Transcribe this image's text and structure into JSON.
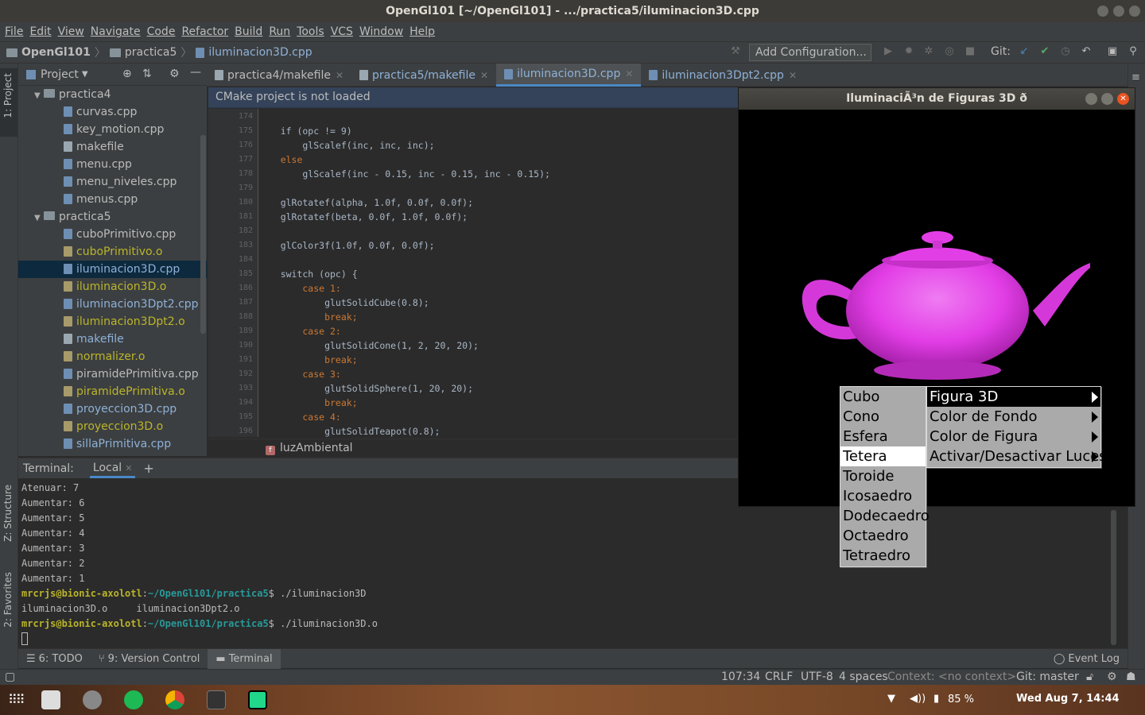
{
  "window": {
    "title": "OpenGl101 [~/OpenGl101] - .../practica5/iluminacion3D.cpp"
  },
  "menubar": [
    "File",
    "Edit",
    "View",
    "Navigate",
    "Code",
    "Refactor",
    "Build",
    "Run",
    "Tools",
    "VCS",
    "Window",
    "Help"
  ],
  "breadcrumb": {
    "project": "OpenGl101",
    "folder": "practica5",
    "file": "iluminacion3D.cpp"
  },
  "toolbar": {
    "add_configuration": "Add Configuration...",
    "git_label": "Git:"
  },
  "project_panel": {
    "title": "Project",
    "strip_label": "1: Project",
    "tree": [
      {
        "label": "practica4",
        "kind": "folder"
      },
      {
        "label": "curvas.cpp",
        "kind": "cpp"
      },
      {
        "label": "key_motion.cpp",
        "kind": "cpp"
      },
      {
        "label": "makefile",
        "kind": "file"
      },
      {
        "label": "menu.cpp",
        "kind": "cpp"
      },
      {
        "label": "menu_niveles.cpp",
        "kind": "cpp"
      },
      {
        "label": "menus.cpp",
        "kind": "cpp"
      },
      {
        "label": "practica5",
        "kind": "folder"
      },
      {
        "label": "cuboPrimitivo.cpp",
        "kind": "cpp"
      },
      {
        "label": "cuboPrimitivo.o",
        "kind": "obj"
      },
      {
        "label": "iluminacion3D.cpp",
        "kind": "cpp"
      },
      {
        "label": "iluminacion3D.o",
        "kind": "obj"
      },
      {
        "label": "iluminacion3Dpt2.cpp",
        "kind": "cpp"
      },
      {
        "label": "iluminacion3Dpt2.o",
        "kind": "obj"
      },
      {
        "label": "makefile",
        "kind": "file"
      },
      {
        "label": "normalizer.o",
        "kind": "obj"
      },
      {
        "label": "piramidePrimitiva.cpp",
        "kind": "cpp"
      },
      {
        "label": "piramidePrimitiva.o",
        "kind": "obj"
      },
      {
        "label": "proyeccion3D.cpp",
        "kind": "cpp"
      },
      {
        "label": "proyeccion3D.o",
        "kind": "obj"
      },
      {
        "label": "sillaPrimitiva.cpp",
        "kind": "cpp"
      }
    ]
  },
  "editor_tabs": [
    "practica4/makefile",
    "practica5/makefile",
    "iluminacion3D.cpp",
    "iluminacion3Dpt2.cpp"
  ],
  "cmake_banner": "CMake project is not loaded",
  "code": {
    "line_numbers": [
      "174",
      "175",
      "176",
      "177",
      "178",
      "179",
      "180",
      "181",
      "182",
      "183",
      "184",
      "185",
      "186",
      "187",
      "188",
      "189",
      "190",
      "191",
      "192",
      "193",
      "194",
      "195",
      "196"
    ],
    "lines": [
      "",
      "    if (opc != 9)",
      "        glScalef(inc, inc, inc);",
      "    else",
      "        glScalef(inc - 0.15, inc - 0.15, inc - 0.15);",
      "",
      "    glRotatef(alpha, 1.0f, 0.0f, 0.0f);",
      "    glRotatef(beta, 0.0f, 1.0f, 0.0f);",
      "",
      "    glColor3f(1.0f, 0.0f, 0.0f);",
      "",
      "    switch (opc) {",
      "        case 1:",
      "            glutSolidCube(0.8);",
      "            break;",
      "        case 2:",
      "            glutSolidCone(1, 2, 20, 20);",
      "            break;",
      "        case 3:",
      "            glutSolidSphere(1, 20, 20);",
      "            break;",
      "        case 4:",
      "            glutSolidTeapot(0.8);"
    ],
    "function_crumb": "luzAmbiental"
  },
  "terminal": {
    "label": "Terminal:",
    "tab": "Local",
    "lines": [
      "Atenuar: 7",
      "Aumentar: 6",
      "Aumentar: 5",
      "Aumentar: 4",
      "Aumentar: 3",
      "Aumentar: 2",
      "Aumentar: 1"
    ],
    "prompt_user": "mrcrjs@bionic-axolotl",
    "prompt_path": "~/OpenGl101/practica5",
    "cmd1": " ./iluminacion3D",
    "ls_output": "iluminacion3D.o     iluminacion3Dpt2.o",
    "cmd2": " ./iluminacion3D.o"
  },
  "side_tabs": {
    "structure": "Z: Structure",
    "favorites": "2: Favorites"
  },
  "bottom_tabs": [
    "6: TODO",
    "9: Version Control",
    "Terminal"
  ],
  "event_log": "Event Log",
  "status": {
    "position": "107:34",
    "line_sep": "CRLF",
    "encoding": "UTF-8",
    "indent": "4 spaces",
    "context": "Context: <no context>",
    "git": "Git: master"
  },
  "gl_window": {
    "title": "IluminaciÃ³n de Figuras 3D ð",
    "shape_color": "#e23ee6",
    "menu_shapes": [
      "Cubo",
      "Cono",
      "Esfera",
      "Tetera",
      "Toroide",
      "Icosaedro",
      "Dodecaedro",
      "Octaedro",
      "Tetraedro"
    ],
    "menu_shapes_selected": "Tetera",
    "menu_main": [
      "Figura 3D",
      "Color de Fondo",
      "Color de Figura",
      "Activar/Desactivar Luces"
    ],
    "menu_main_selected": "Figura 3D"
  },
  "taskbar": {
    "battery": "85 %",
    "clock": "Wed Aug  7, 14:44"
  }
}
